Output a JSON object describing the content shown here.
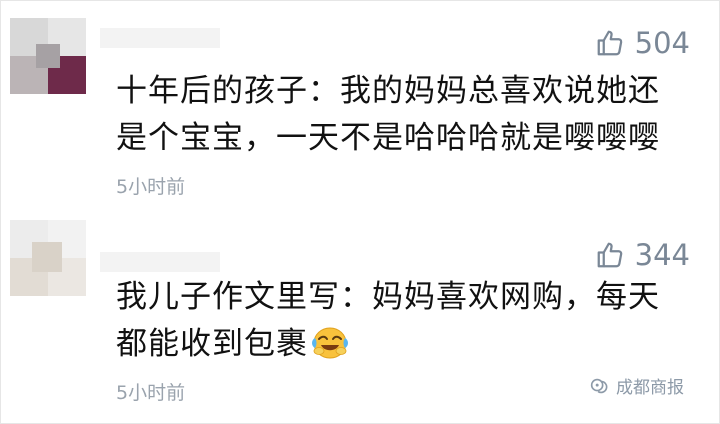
{
  "comments": [
    {
      "likes": "504",
      "text_line1": "十年后的孩子：我的妈妈总喜欢说她还",
      "text_line2": "是个宝宝，一天不是哈哈哈就是嘤嘤嘤",
      "time": "5小时前"
    },
    {
      "likes": "344",
      "text_line1": "我儿子作文里写：妈妈喜欢网购，每天",
      "text_line2": "都能收到包裹",
      "emoji": "crying-laughing-face",
      "time": "5小时前"
    }
  ],
  "watermark": {
    "label": "成都商报",
    "icon": "wechat-official-icon"
  },
  "colors": {
    "text": "#111111",
    "meta": "#7a8796",
    "time": "#9aa3ad"
  }
}
